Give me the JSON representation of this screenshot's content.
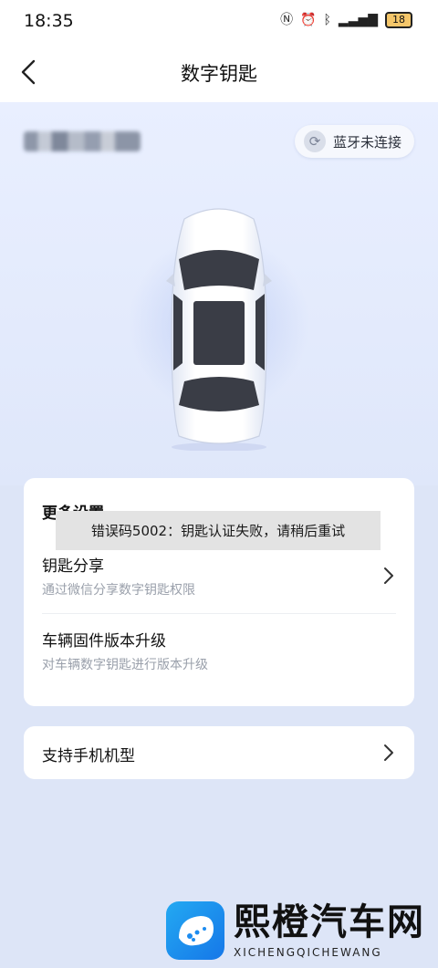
{
  "status_bar": {
    "time": "18:35",
    "battery": "18"
  },
  "nav": {
    "title": "数字钥匙"
  },
  "vehicle": {
    "bluetooth_status": "蓝牙未连接"
  },
  "settings": {
    "title": "更多设置",
    "items": [
      {
        "title": "钥匙分享",
        "subtitle": "通过微信分享数字钥匙权限"
      },
      {
        "title": "车辆固件版本升级",
        "subtitle": "对车辆数字钥匙进行版本升级"
      }
    ]
  },
  "support": {
    "label": "支持手机机型"
  },
  "toast": {
    "message": "错误码5002：钥匙认证失败，请稍后重试"
  },
  "watermark": {
    "title": "熙橙汽车网",
    "subtitle": "XICHENGQICHEWANG"
  }
}
